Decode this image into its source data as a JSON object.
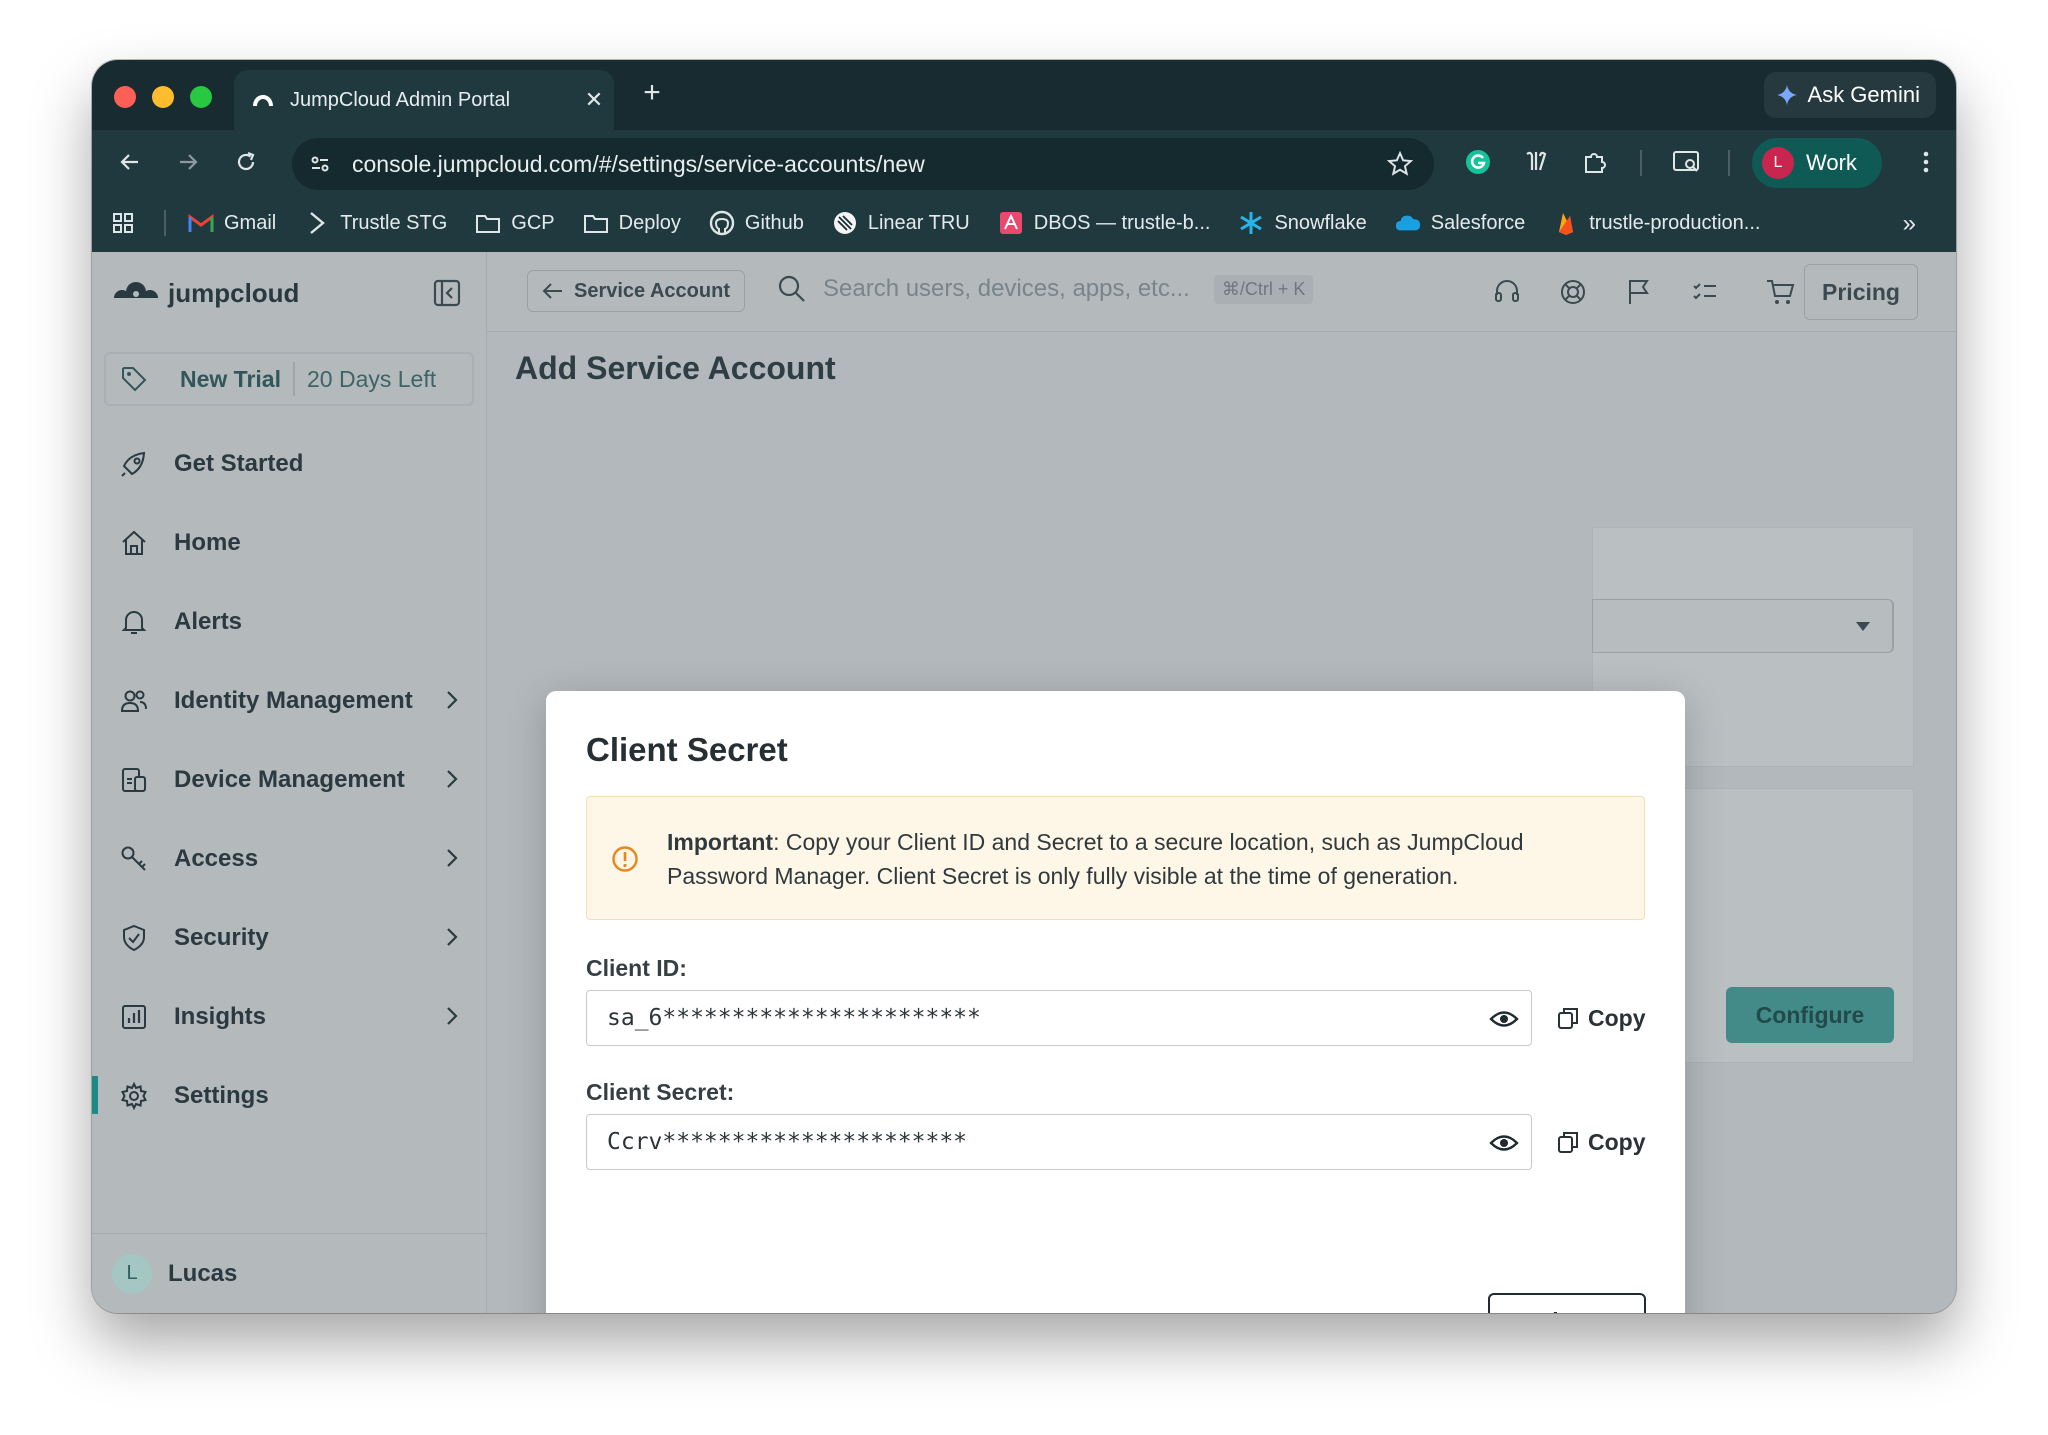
{
  "browser": {
    "tab_title": "JumpCloud Admin Portal",
    "url": "console.jumpcloud.com/#/settings/service-accounts/new",
    "gemini_label": "Ask Gemini",
    "profile_initial": "L",
    "profile_label": "Work",
    "bookmarks": [
      {
        "label": "Gmail",
        "icon": "gmail-icon"
      },
      {
        "label": "Trustle STG",
        "icon": "chevron-right-icon"
      },
      {
        "label": "GCP",
        "icon": "folder-icon"
      },
      {
        "label": "Deploy",
        "icon": "folder-icon"
      },
      {
        "label": "Github",
        "icon": "github-icon"
      },
      {
        "label": "Linear TRU",
        "icon": "linear-icon"
      },
      {
        "label": "DBOS — trustle-b...",
        "icon": "dbos-icon"
      },
      {
        "label": "Snowflake",
        "icon": "snowflake-icon"
      },
      {
        "label": "Salesforce",
        "icon": "salesforce-icon"
      },
      {
        "label": "trustle-production...",
        "icon": "firebase-icon"
      }
    ],
    "bookmarks_more": "»"
  },
  "sidebar": {
    "logo_text": "jumpcloud",
    "trial_label": "New Trial",
    "trial_days": "20 Days Left",
    "items": [
      {
        "label": "Get Started",
        "icon": "rocket-icon",
        "chevron": false
      },
      {
        "label": "Home",
        "icon": "home-icon",
        "chevron": false
      },
      {
        "label": "Alerts",
        "icon": "bell-icon",
        "chevron": false
      },
      {
        "label": "Identity Management",
        "icon": "users-icon",
        "chevron": true
      },
      {
        "label": "Device Management",
        "icon": "devices-icon",
        "chevron": true
      },
      {
        "label": "Access",
        "icon": "key-icon",
        "chevron": true
      },
      {
        "label": "Security",
        "icon": "shield-icon",
        "chevron": true
      },
      {
        "label": "Insights",
        "icon": "chart-icon",
        "chevron": true
      },
      {
        "label": "Settings",
        "icon": "gear-icon",
        "chevron": false,
        "active": true
      }
    ],
    "user_initial": "L",
    "user_name": "Lucas"
  },
  "topbar": {
    "back_label": "Service Account",
    "search_placeholder": "Search users, devices, apps, etc...",
    "search_shortcut": "⌘/Ctrl + K",
    "pricing_label": "Pricing"
  },
  "page": {
    "title": "Add Service Account",
    "configure_label": "Configure"
  },
  "modal": {
    "title": "Client Secret",
    "alert_strong": "Important",
    "alert_text": ": Copy your Client ID and Secret to a secure location, such as JumpCloud Password Manager. Client Secret is only fully visible at the time of generation.",
    "client_id_label": "Client ID:",
    "client_id_value": "sa_6***********************",
    "client_secret_label": "Client Secret:",
    "client_secret_value": "Ccrv**********************",
    "copy_label": "Copy",
    "close_label": "Close"
  },
  "colors": {
    "accent": "#1c8b88",
    "warning": "#e8871e",
    "browser_chrome": "#20393f"
  }
}
